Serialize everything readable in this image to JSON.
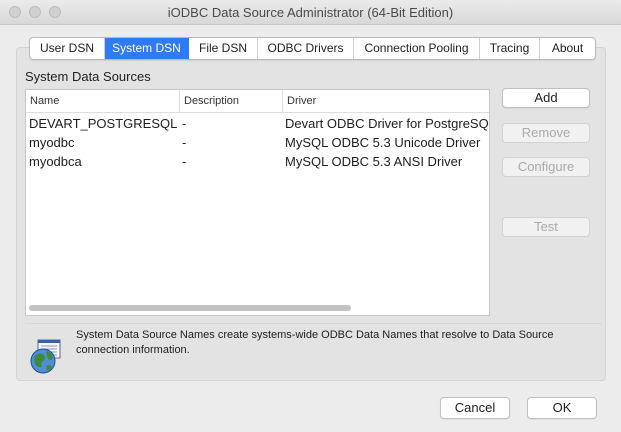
{
  "window": {
    "title": "iODBC Data Source Administrator  (64-Bit Edition)"
  },
  "tabs": [
    {
      "label": "User DSN"
    },
    {
      "label": "System DSN",
      "active": true
    },
    {
      "label": "File DSN"
    },
    {
      "label": "ODBC Drivers"
    },
    {
      "label": "Connection Pooling"
    },
    {
      "label": "Tracing"
    },
    {
      "label": "About"
    }
  ],
  "section_title": "System Data Sources",
  "table": {
    "columns": [
      "Name",
      "Description",
      "Driver"
    ],
    "rows": [
      {
        "name": "DEVART_POSTGRESQL",
        "description": "-",
        "driver": "Devart ODBC Driver for PostgreSQL"
      },
      {
        "name": "myodbc",
        "description": "-",
        "driver": "MySQL ODBC 5.3 Unicode Driver"
      },
      {
        "name": "myodbca",
        "description": "-",
        "driver": "MySQL ODBC 5.3 ANSI Driver"
      }
    ]
  },
  "buttons": {
    "add": "Add",
    "remove": "Remove",
    "configure": "Configure",
    "test": "Test",
    "cancel": "Cancel",
    "ok": "OK"
  },
  "info": {
    "text": "System Data Source Names create systems-wide ODBC Data Names that resolve to Data Source connection information.",
    "icon": "dsn-globe-icon"
  },
  "colors": {
    "accent": "#2f7bf5"
  }
}
